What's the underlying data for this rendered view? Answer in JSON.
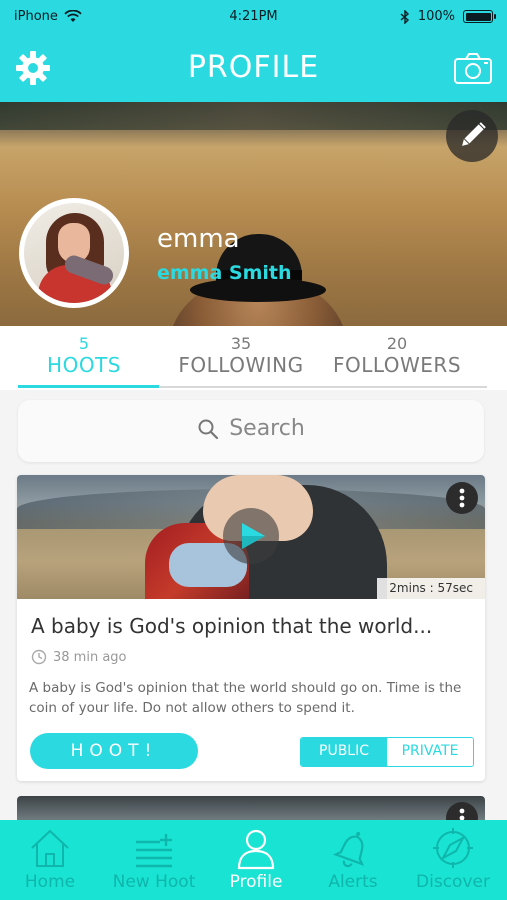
{
  "status_bar": {
    "carrier": "iPhone",
    "time": "4:21PM",
    "battery": "100%",
    "battery_level": 1.0
  },
  "header": {
    "title": "PROFILE",
    "left_icon": "gear-icon",
    "right_icon": "camera-icon"
  },
  "profile": {
    "username": "emma",
    "full_name": "emma Smith",
    "edit_icon": "pencil-icon"
  },
  "stats": [
    {
      "count": "5",
      "label": "HOOTS",
      "active": true
    },
    {
      "count": "35",
      "label": "FOLLOWING",
      "active": false
    },
    {
      "count": "20",
      "label": "FOLLOWERS",
      "active": false
    }
  ],
  "search": {
    "placeholder": "Search"
  },
  "post": {
    "duration": "2mins : 57sec",
    "title": "A baby is God's opinion that the world...",
    "time_ago": "38 min ago",
    "body": "A baby is God's opinion that the world should go on. Time is the coin of your life. Do not allow others to spend it.",
    "hoot_button": "HOOT!",
    "visibility": {
      "public": "PUBLIC",
      "private": "PRIVATE",
      "selected": "PUBLIC"
    }
  },
  "tab_bar": [
    {
      "label": "Home",
      "icon": "home-icon",
      "active": false
    },
    {
      "label": "New Hoot",
      "icon": "new-hoot-icon",
      "active": false
    },
    {
      "label": "Profile",
      "icon": "person-icon",
      "active": true
    },
    {
      "label": "Alerts",
      "icon": "bell-icon",
      "active": false
    },
    {
      "label": "Discover",
      "icon": "compass-icon",
      "active": false
    }
  ],
  "colors": {
    "accent": "#2bd9e0",
    "tab_bar": "#19e3d2",
    "tab_inactive": "#0fb6ab"
  }
}
